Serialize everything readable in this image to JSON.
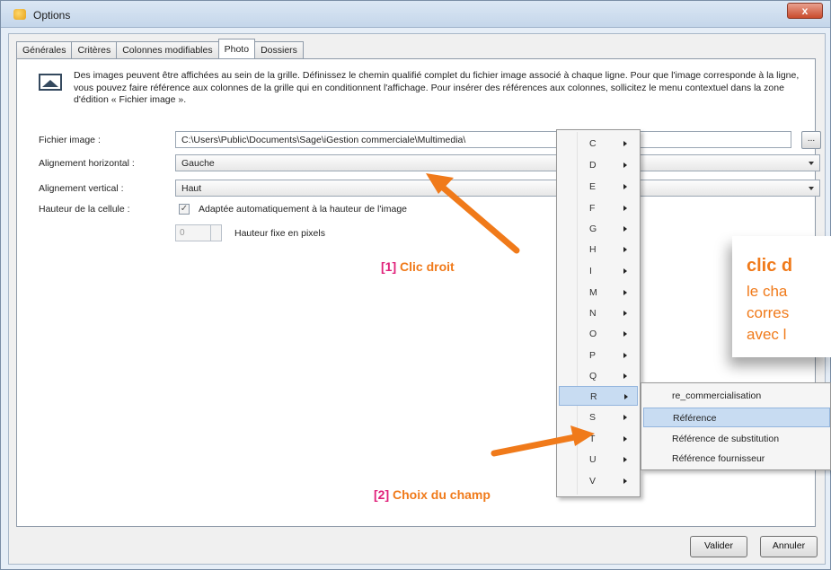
{
  "window": {
    "title": "Options",
    "close_label": "x"
  },
  "tabs": [
    {
      "label": "Générales",
      "active": false
    },
    {
      "label": "Critères",
      "active": false
    },
    {
      "label": "Colonnes modifiables",
      "active": false
    },
    {
      "label": "Photo",
      "active": true
    },
    {
      "label": "Dossiers",
      "active": false
    }
  ],
  "photo": {
    "description": "Des images peuvent être affichées au sein de la grille. Définissez le chemin qualifié complet du fichier image associé à chaque ligne. Pour que l'image corresponde à la ligne, vous pouvez faire référence aux colonnes de la grille qui en conditionnent l'affichage. Pour insérer des références aux colonnes, sollicitez le menu contextuel dans la zone d'édition « Fichier image ».",
    "file_label": "Fichier image :",
    "file_value": "C:\\Users\\Public\\Documents\\Sage\\iGestion commerciale\\Multimedia\\",
    "browse_label": "...",
    "halign_label": "Alignement horizontal :",
    "halign_value": "Gauche",
    "valign_label": "Alignement vertical :",
    "valign_value": "Haut",
    "height_label": "Hauteur de la cellule :",
    "auto_check": "✓",
    "auto_label": "Adaptée automatiquement à la hauteur de l'image",
    "fixed_value": "0",
    "fixed_label": "Hauteur fixe en pixels"
  },
  "context_menu": {
    "items": [
      "C",
      "D",
      "E",
      "F",
      "G",
      "H",
      "I",
      "M",
      "N",
      "O",
      "P",
      "Q",
      "R",
      "S",
      "T",
      "U",
      "V"
    ],
    "highlighted": "R"
  },
  "submenu": {
    "items": [
      "re_commercialisation",
      "Référence",
      "Référence de substitution",
      "Référence fournisseur"
    ],
    "highlighted": "Référence"
  },
  "buttons": {
    "ok": "Valider",
    "cancel": "Annuler"
  },
  "annotations": {
    "step1_num": "[1]",
    "step1_text": "Clic droit",
    "step2_num": "[2]",
    "step2_text": "Choix du champ"
  },
  "callout": {
    "head": "clic d",
    "lines": [
      "le cha",
      "corres",
      "avec l"
    ]
  },
  "colors": {
    "accent": "#f07a1a",
    "step": "#e0207a",
    "highlight": "#c8dcf2"
  }
}
